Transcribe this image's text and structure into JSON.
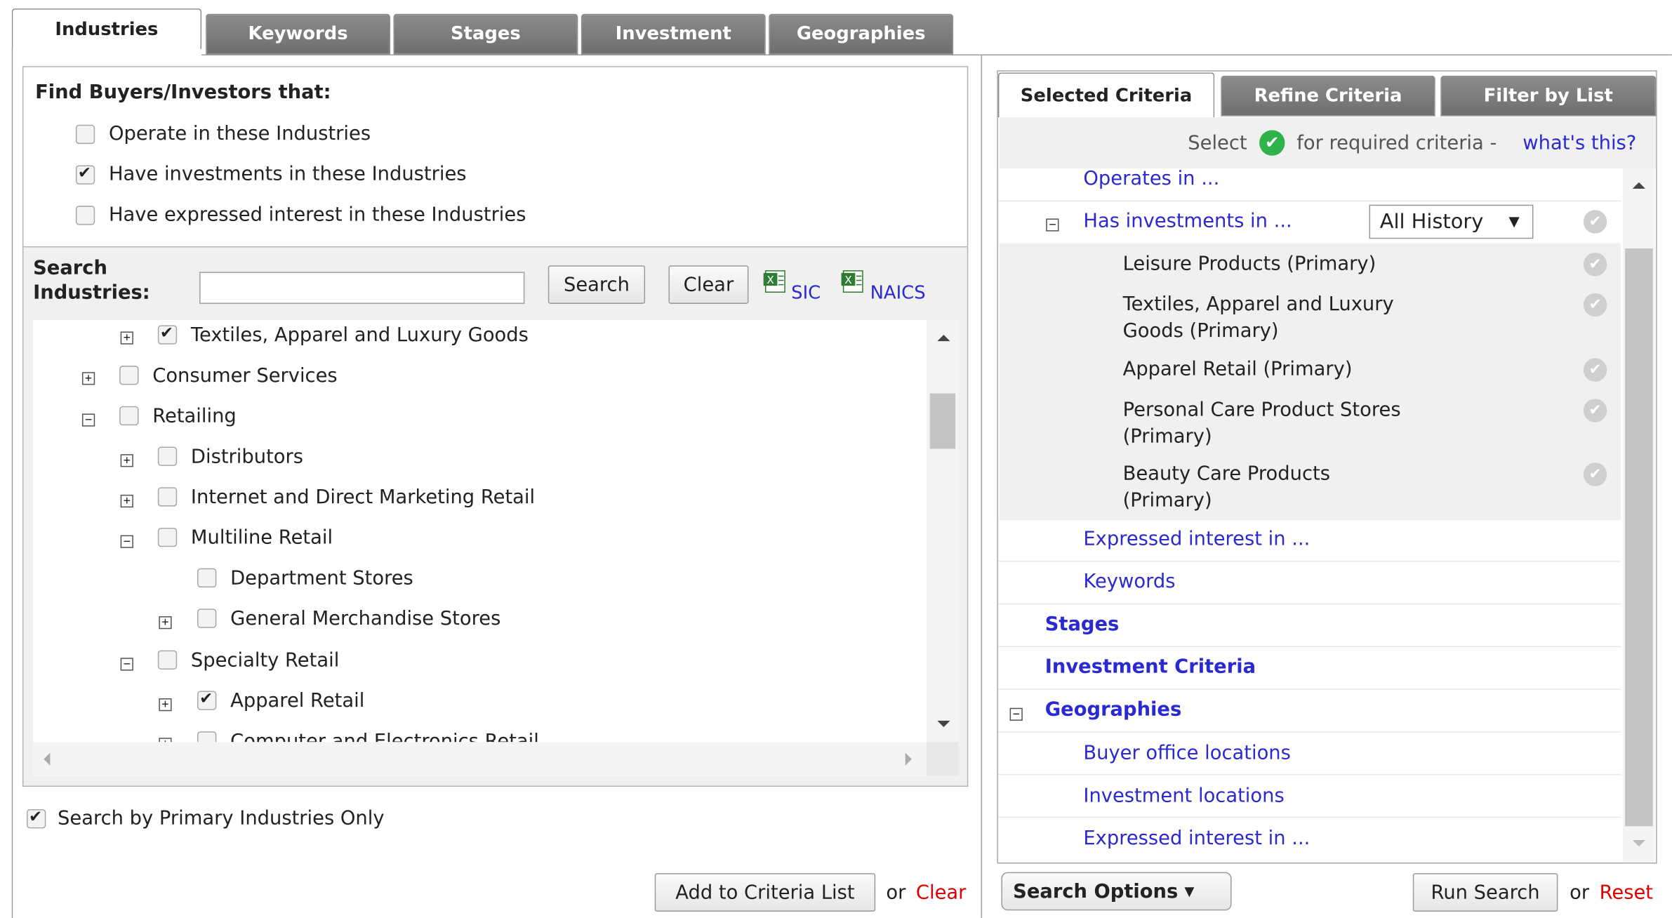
{
  "left_tabs": [
    "Industries",
    "Keywords",
    "Stages",
    "Investment",
    "Geographies"
  ],
  "find": {
    "heading": "Find Buyers/Investors that:",
    "options": [
      {
        "label": "Operate in these Industries",
        "checked": false
      },
      {
        "label": "Have investments in these Industries",
        "checked": true
      },
      {
        "label": "Have expressed interest in these Industries",
        "checked": false
      }
    ]
  },
  "search": {
    "label_line1": "Search",
    "label_line2": "Industries:",
    "input_value": "",
    "search_button": "Search",
    "clear_button": "Clear",
    "sic_link": "SIC",
    "naics_link": "NAICS"
  },
  "tree": [
    {
      "label": "Textiles, Apparel and Luxury Goods",
      "checked": true,
      "expander": "+"
    },
    {
      "label": "Consumer Services",
      "checked": false,
      "expander": "+"
    },
    {
      "label": "Retailing",
      "checked": false,
      "expander": "−"
    },
    {
      "label": "Distributors",
      "checked": false,
      "expander": "+"
    },
    {
      "label": "Internet and Direct Marketing Retail",
      "checked": false,
      "expander": "+"
    },
    {
      "label": "Multiline Retail",
      "checked": false,
      "expander": "−"
    },
    {
      "label": "Department Stores",
      "checked": false,
      "expander": ""
    },
    {
      "label": "General Merchandise Stores",
      "checked": false,
      "expander": "+"
    },
    {
      "label": "Specialty Retail",
      "checked": false,
      "expander": "−"
    },
    {
      "label": "Apparel Retail",
      "checked": true,
      "expander": "+"
    },
    {
      "label": "Computer and Electronics Retail",
      "checked": false,
      "expander": "+"
    }
  ],
  "primary_only": {
    "label": "Search by Primary Industries Only",
    "checked": true
  },
  "left_footer": {
    "add_button": "Add to Criteria List",
    "or": "or",
    "clear_link": "Clear"
  },
  "right_tabs": [
    "Selected Criteria",
    "Refine Criteria",
    "Filter by List"
  ],
  "hint": {
    "select": "Select",
    "rest": "for required criteria -",
    "link": "what's this?"
  },
  "criteria": {
    "operates_in": "Operates in ...",
    "has_investments": "Has investments in ...",
    "history_select": "All History",
    "investment_items": [
      [
        "Leisure Products (Primary)"
      ],
      [
        "Textiles, Apparel and Luxury",
        "Goods (Primary)"
      ],
      [
        "Apparel Retail (Primary)"
      ],
      [
        "Personal Care Product Stores",
        "(Primary)"
      ],
      [
        "Beauty Care Products",
        "(Primary)"
      ]
    ],
    "expressed_interest": "Expressed interest in ...",
    "keywords": "Keywords",
    "stages": "Stages",
    "investment_criteria": "Investment Criteria",
    "geographies": "Geographies",
    "buyer_office": "Buyer office locations",
    "investment_locations": "Investment locations",
    "geo_expressed_interest": "Expressed interest in ..."
  },
  "right_footer": {
    "search_options": "Search Options",
    "run_search": "Run Search",
    "or": "or",
    "reset_link": "Reset"
  },
  "colors": {
    "link": "#2a2ad0",
    "red_link": "#e00000",
    "check_green": "#2fb24a",
    "tab_gray": "#777777"
  }
}
